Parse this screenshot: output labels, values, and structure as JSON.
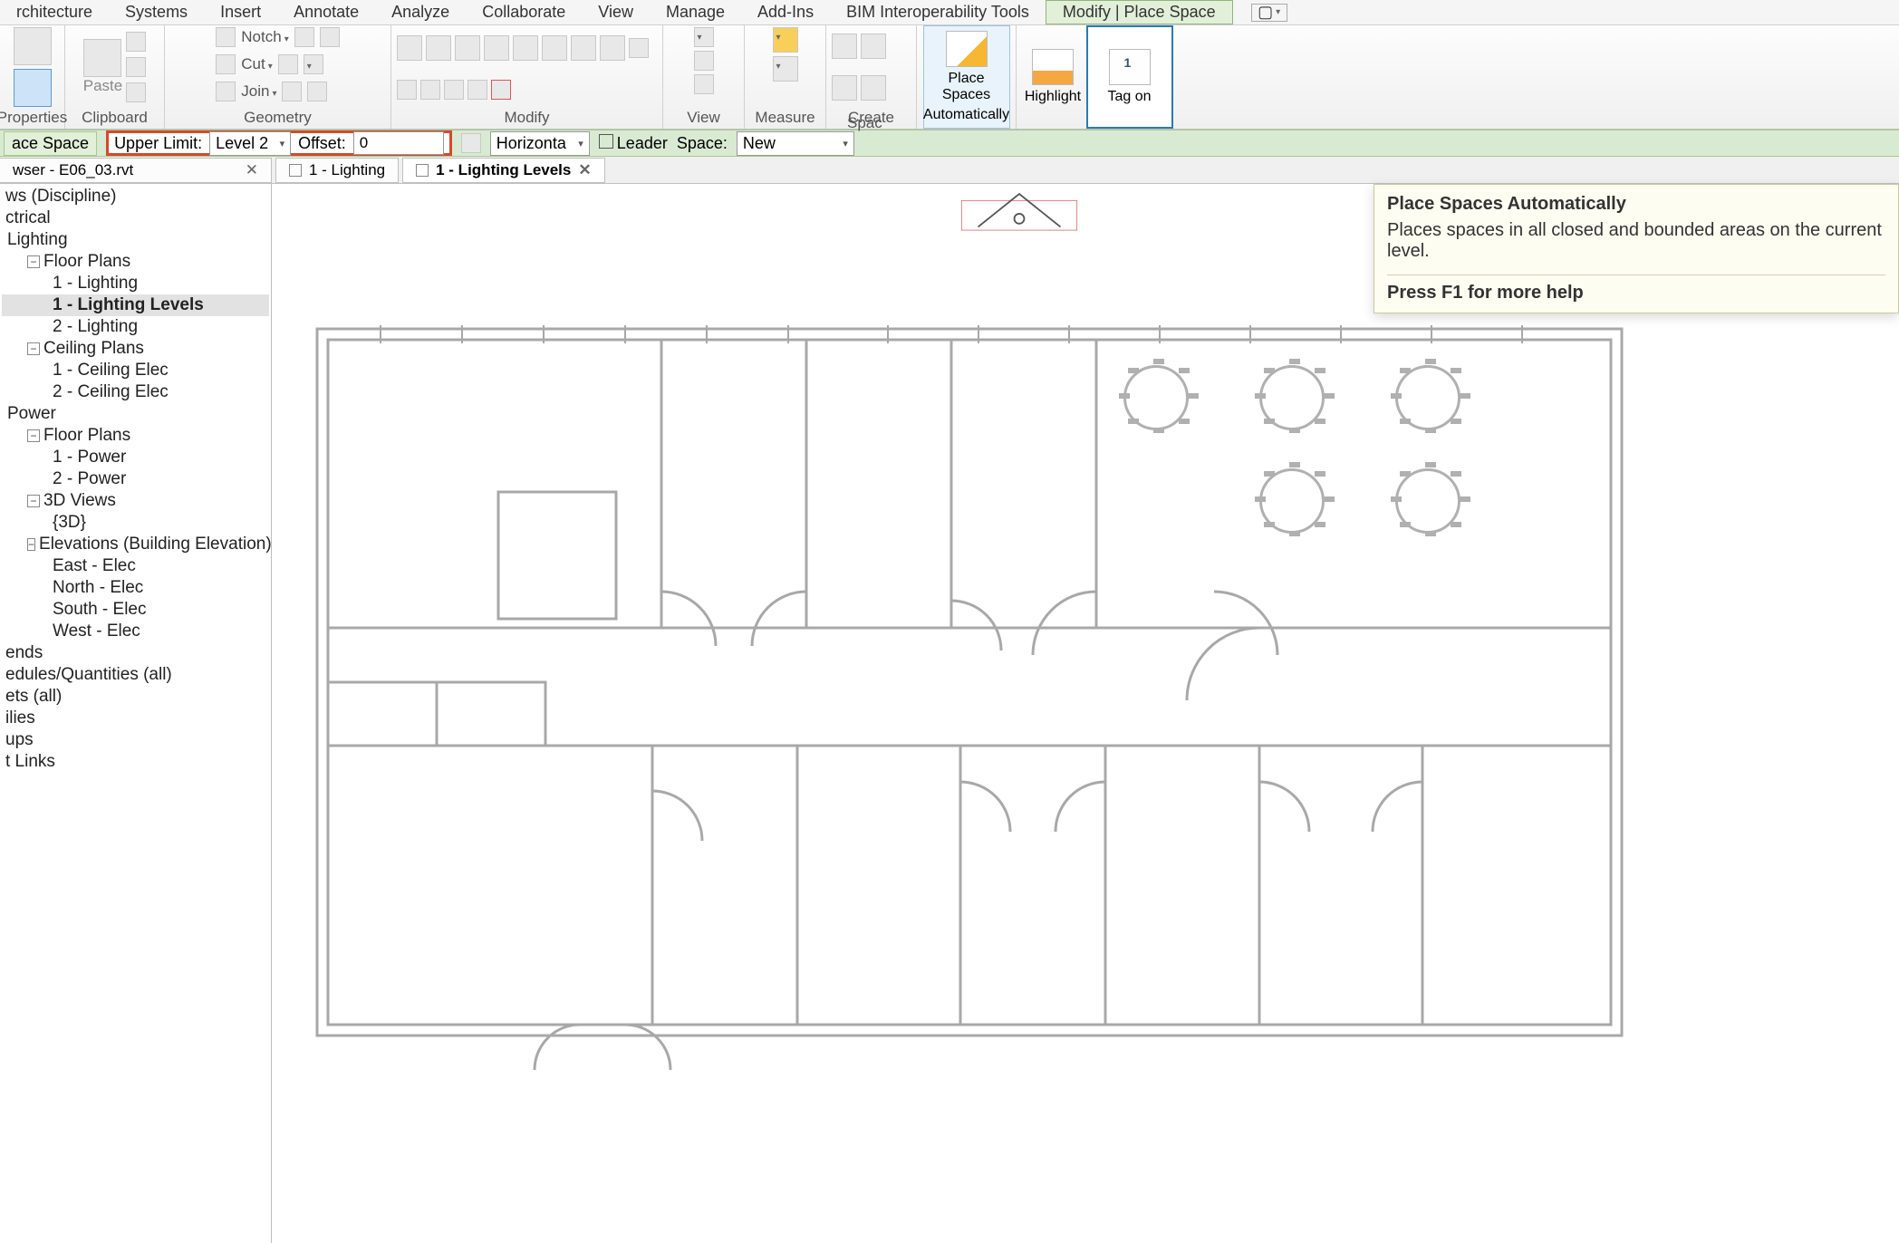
{
  "menu": {
    "items": [
      "rchitecture",
      "Systems",
      "Insert",
      "Annotate",
      "Analyze",
      "Collaborate",
      "View",
      "Manage",
      "Add-Ins",
      "BIM Interoperability Tools",
      "Modify | Place Space"
    ]
  },
  "ribbon": {
    "properties_label": "Properties",
    "clipboard": {
      "paste": "Paste",
      "label": "Clipboard"
    },
    "geometry": {
      "notch": "Notch",
      "cut": "Cut",
      "join": "Join",
      "label": "Geometry"
    },
    "modify_label": "Modify",
    "view_label": "View",
    "measure_label": "Measure",
    "create_label": "Create",
    "space_tools_label": "Spac",
    "place_spaces_line1": "Place Spaces",
    "place_spaces_line2": "Automatically",
    "highlight": "Highlight",
    "tag_on": "Tag on"
  },
  "options": {
    "ace_space": "ace Space",
    "upper_limit": "Upper Limit:",
    "upper_limit_value": "Level 2",
    "offset_label": "Offset:",
    "offset_value": "0",
    "tag_orientation": "Horizonta",
    "leader": "Leader",
    "space_label": "Space:",
    "space_value": "New"
  },
  "doc_title": "wser - E06_03.rvt",
  "tabs": {
    "lighting": "1 - Lighting",
    "lighting_levels": "1 - Lighting Levels"
  },
  "browser": {
    "discipline": "ws (Discipline)",
    "electrical": "ctrical",
    "lighting": "Lighting",
    "floor_plans": "Floor Plans",
    "l1_lighting": "1 - Lighting",
    "l1_lighting_levels": "1 - Lighting Levels",
    "l2_lighting": "2 - Lighting",
    "ceiling_plans": "Ceiling Plans",
    "c1": "1 - Ceiling Elec",
    "c2": "2 - Ceiling Elec",
    "power": "Power",
    "floor_plans2": "Floor Plans",
    "p1": "1 - Power",
    "p2": "2 - Power",
    "views3d": "3D Views",
    "v3d": "{3D}",
    "elevations": "Elevations (Building Elevation)",
    "east": "East - Elec",
    "north": "North - Elec",
    "south": "South - Elec",
    "west": "West - Elec",
    "ends": "ends",
    "schedules": "edules/Quantities (all)",
    "ets": "ets (all)",
    "ilies": "ilies",
    "ups": "ups",
    "links": "t Links"
  },
  "tooltip": {
    "title": "Place Spaces Automatically",
    "body": "Places spaces in all closed and bounded areas on the current level.",
    "footer": "Press F1 for more help"
  }
}
